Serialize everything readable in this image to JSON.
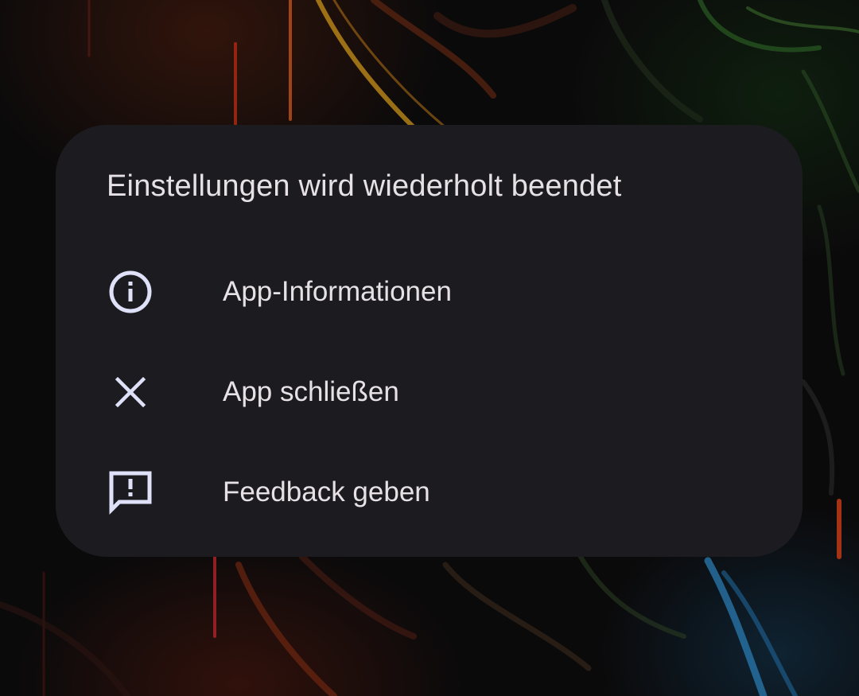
{
  "dialog": {
    "title": "Einstellungen wird wiederholt beendet",
    "options": [
      {
        "label": "App-Informationen",
        "icon": "info-icon"
      },
      {
        "label": "App schließen",
        "icon": "close-icon"
      },
      {
        "label": "Feedback geben",
        "icon": "feedback-icon"
      }
    ]
  },
  "colors": {
    "dialog_background": "#1c1b1f",
    "text": "#e6e1e5",
    "icon": "#dfe1f9"
  }
}
